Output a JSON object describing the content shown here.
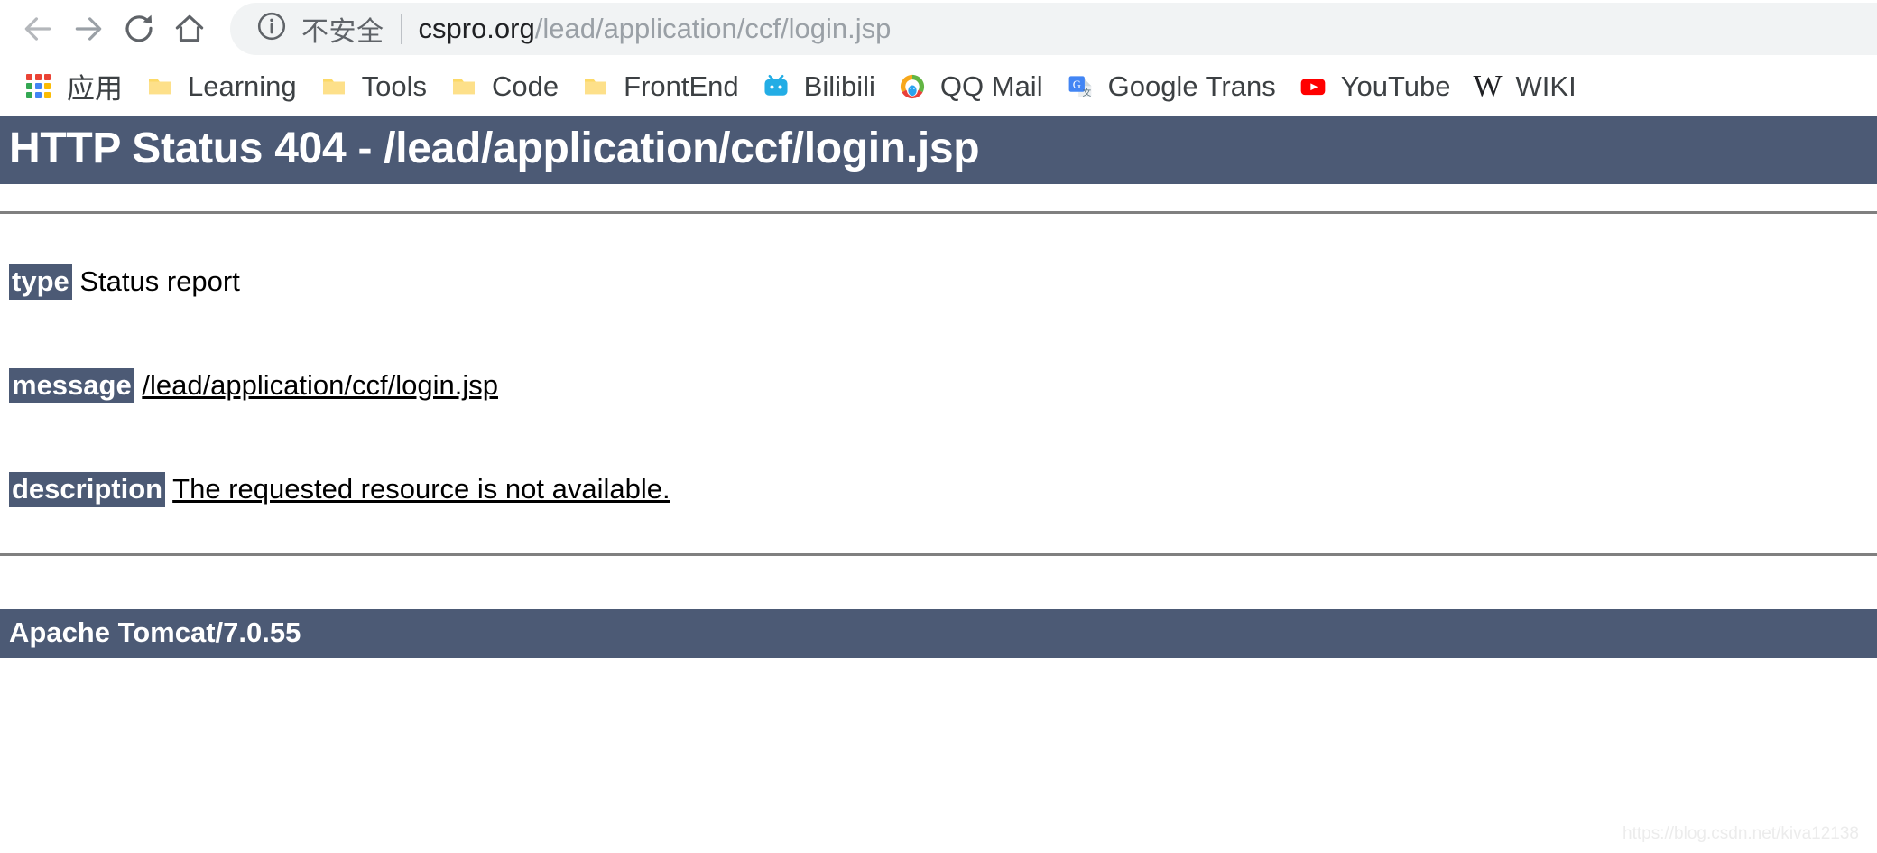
{
  "browser": {
    "nav": {
      "back_icon": "arrow-left-icon",
      "forward_icon": "arrow-right-icon",
      "reload_icon": "reload-icon",
      "home_icon": "home-icon"
    },
    "omnibox": {
      "security_icon": "info-circle-icon",
      "security_text": "不安全",
      "url_host": "cspro.org",
      "url_path": "/lead/application/ccf/login.jsp",
      "full_url": "cspro.org/lead/application/ccf/login.jsp"
    },
    "bookmarks": [
      {
        "label": "应用",
        "icon": "apps-grid-icon"
      },
      {
        "label": "Learning",
        "icon": "folder-icon"
      },
      {
        "label": "Tools",
        "icon": "folder-icon"
      },
      {
        "label": "Code",
        "icon": "folder-icon"
      },
      {
        "label": "FrontEnd",
        "icon": "folder-icon"
      },
      {
        "label": "Bilibili",
        "icon": "bilibili-tv-icon"
      },
      {
        "label": "QQ Mail",
        "icon": "qq-mail-icon"
      },
      {
        "label": "Google Trans",
        "icon": "google-translate-icon"
      },
      {
        "label": "YouTube",
        "icon": "youtube-play-icon"
      },
      {
        "label": "WIKI",
        "icon": "wikipedia-w-icon"
      }
    ]
  },
  "page": {
    "status_heading": "HTTP Status 404 - /lead/application/ccf/login.jsp",
    "rows": [
      {
        "key": "type",
        "value": "Status report",
        "underlined": false
      },
      {
        "key": "message",
        "value": "/lead/application/ccf/login.jsp",
        "underlined": true
      },
      {
        "key": "description",
        "value": "The requested resource is not available.",
        "underlined": true
      }
    ],
    "footer": "Apache Tomcat/7.0.55",
    "watermark": "https://blog.csdn.net/kiva12138"
  },
  "colors": {
    "banner_bg": "#4c5a75",
    "banner_text": "#ffffff",
    "rule": "#808080",
    "omnibox_bg": "#f1f3f4",
    "url_host_color": "#202124",
    "url_path_color": "#9aa0a6"
  }
}
